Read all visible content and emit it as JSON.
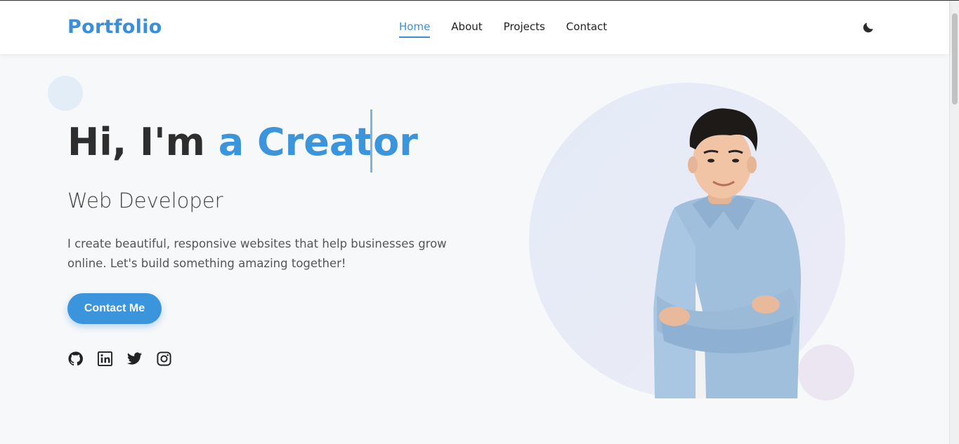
{
  "nav": {
    "logo": "Portfolio",
    "links": [
      {
        "label": "Home",
        "active": true
      },
      {
        "label": "About",
        "active": false
      },
      {
        "label": "Projects",
        "active": false
      },
      {
        "label": "Contact",
        "active": false
      }
    ],
    "theme_toggle_icon": "moon-icon"
  },
  "hero": {
    "title_prefix": "Hi, I'm",
    "title_accent": "a Creator",
    "subtitle": "Web Developer",
    "description": "I create beautiful, responsive websites that help businesses grow online. Let's build something amazing together!",
    "cta_label": "Contact Me",
    "socials": [
      "github-icon",
      "linkedin-icon",
      "twitter-icon",
      "instagram-icon"
    ]
  },
  "colors": {
    "accent": "#3a95dc",
    "text": "#2e2e2e",
    "background": "#f7f8fa"
  }
}
